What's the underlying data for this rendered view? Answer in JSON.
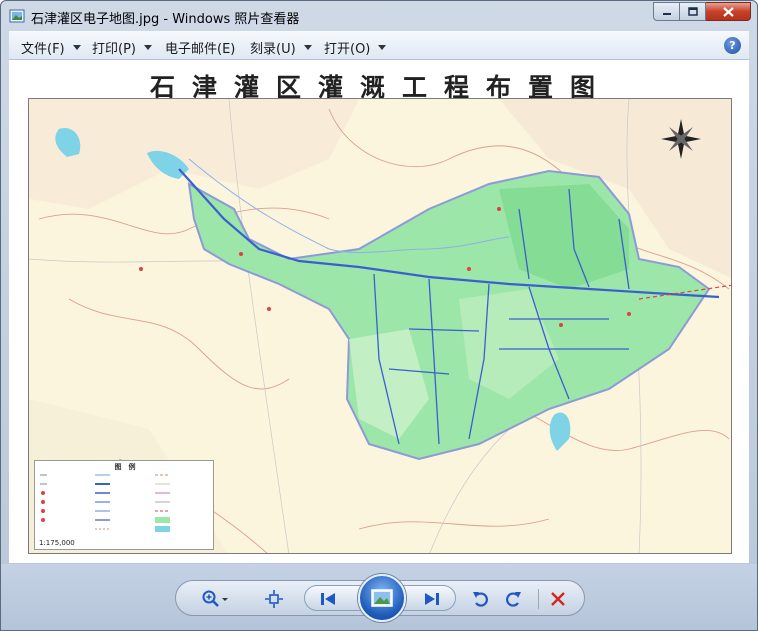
{
  "window": {
    "title": "石津灌区电子地图.jpg - Windows 照片查看器"
  },
  "menu": {
    "file": "文件(F)",
    "print": "打印(P)",
    "email": "电子邮件(E)",
    "burn": "刻录(U)",
    "open": "打开(O)",
    "help_glyph": "?"
  },
  "map": {
    "title": "石津灌区灌溉工程布置图",
    "legend_title": "图　例",
    "scale": "1:175,000"
  },
  "toolbar": {
    "icons": [
      "zoom-icon",
      "actual-size-icon",
      "previous-icon",
      "slideshow-icon",
      "next-icon",
      "rotate-ccw-icon",
      "rotate-cw-icon",
      "delete-icon"
    ]
  },
  "colors": {
    "irrigation_area": "#9be6a8",
    "main_canal": "#3a5fd0",
    "background_land": "#fbf5dd",
    "delete_red": "#d4261b"
  }
}
